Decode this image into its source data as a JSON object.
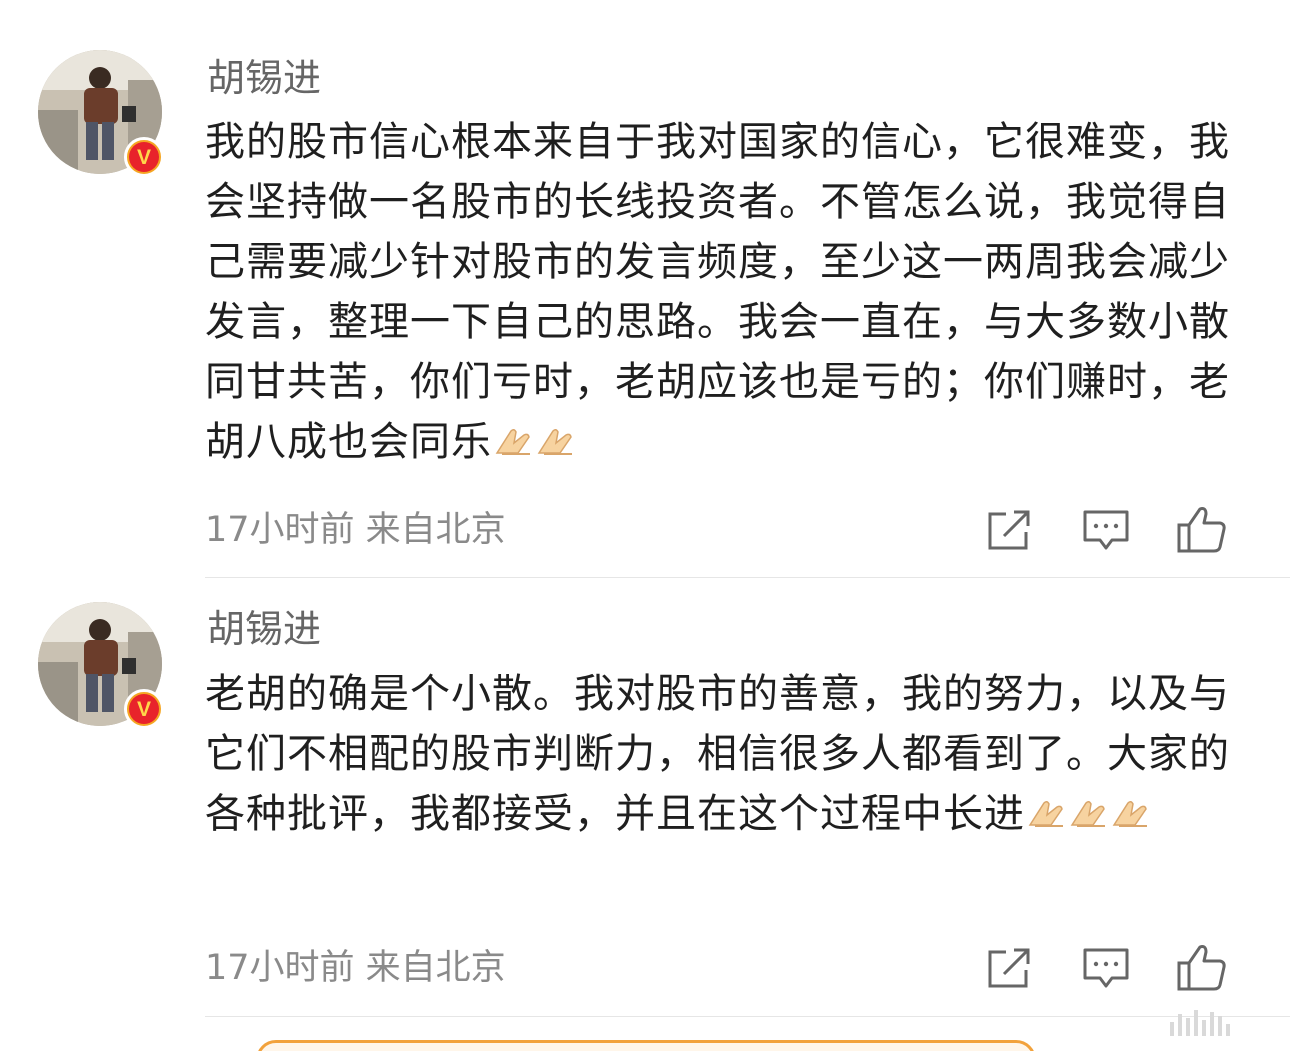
{
  "posts": [
    {
      "author": "胡锡进",
      "content": "我的股市信心根本来自于我对国家的信心，它很难变，我会坚持做一名股市的长线投资者。不管怎么说，我觉得自己需要减少针对股市的发言频度，至少这一两周我会减少发言，整理一下自己的思路。我会一直在，与大多数小散同甘共苦，你们亏时，老胡应该也是亏的；你们赚时，老胡八成也会同乐",
      "emoji_count": 2,
      "meta": "17小时前 来自北京"
    },
    {
      "author": "胡锡进",
      "content": "老胡的确是个小散。我对股市的善意，我的努力，以及与它们不相配的股市判断力，相信很多人都看到了。大家的各种批评，我都接受，并且在这个过程中长进",
      "emoji_count": 3,
      "meta": "17小时前 来自北京"
    }
  ],
  "icons": {
    "share": "share-icon",
    "comment": "comment-icon",
    "like": "like-icon",
    "verified": "verified-badge-icon",
    "emoji": "pray-hands-icon"
  },
  "badge": {
    "letter": "V"
  },
  "colors": {
    "author": "#666666",
    "meta": "#8a8a8a",
    "badge_outer": "#f5a623",
    "badge_inner": "#e8232b",
    "icon": "#666666"
  }
}
